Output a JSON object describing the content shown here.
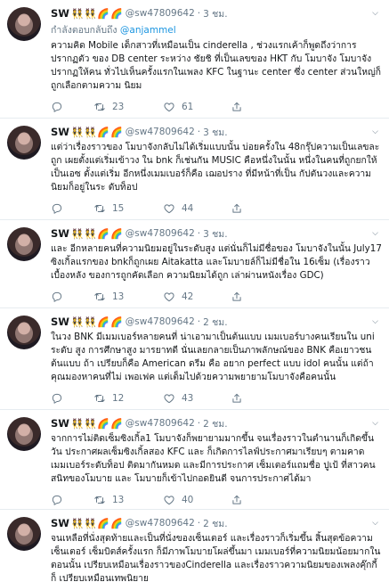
{
  "tweets": [
    {
      "name": "SW",
      "handle": "@sw47809642",
      "time": "3 ชม.",
      "reply_prefix": "กำลังตอบกลับถึง ",
      "reply_mention": "@anjammel",
      "text": "ความคิด Mobile เด็กสาวที่เหมือนเป็น cinderella , ช่วงแรกเค้าก็พูดถึงว่าการปรากฏตัว ของ DB center ระหว่าง ชัยชิ ที่เป็นเลขของ HKT กับ โมบาจัง โมบาจังปรากฏให้คน ทั่วไปเห็นครั้งแรกในเพลง KFC ในฐานะ center ซึ่ง center ส่วนใหญ่ก็ถูกเลือกตามความ นิยม",
      "retweets": "23",
      "likes": "61"
    },
    {
      "name": "SW",
      "handle": "@sw47809642",
      "time": "3 ชม.",
      "reply_prefix": "",
      "reply_mention": "",
      "text": "แต่ว่าเรื่องราวของ โมบาจังกลับไม่ได้เริ่มแบบนั้น บ่อยครั้งใน 48กรุ๊ปความเป็นเลขละถูก เผยตั้งแต่เริ่มเข้าวง ใน bnk ก็เช่นกัน MUSIC คือหนึ่งในนั้น หนึ่งในคนที่ถูกยกให้เป็นเอซ ตั้งแต่เริ่ม อีกหนึ่งเมมเบอร์ก็คือ เฌอปราง ที่มีหน้าที่เป็น กัปตันวงและความนิยมก็อยู่ในระ ดับท็อป",
      "retweets": "15",
      "likes": "44"
    },
    {
      "name": "SW",
      "handle": "@sw47809642",
      "time": "3 ชม.",
      "reply_prefix": "",
      "reply_mention": "",
      "text": "และ อีกหลายคนที่ความนิยมอยู่ในระดับสูง แต่นั่นก็ไม่มีชื่อของ โมบาจังในนั้น July17 ซิงเกิ้ลแรกของ bnkก็ถูกเผย Aitakatta และโมบายล์ก็ไม่มีชื่อใน 16เซ็ม (เรื่องราว เบื้องหลัง ของการถูกคัดเลือก ความนิยมได้ถูก เล่าผ่านหนังเรื่อง GDC)",
      "retweets": "13",
      "likes": "42"
    },
    {
      "name": "SW",
      "handle": "@sw47809642",
      "time": "2 ชม.",
      "reply_prefix": "",
      "reply_mention": "",
      "text": "ในวง BNK มีเมมเบอร์หลายคนที่ น่าเอามาเป็นต้นแบบ เมมเบอร์บางคนเรียนใน uni ระดับ สูง การศึกษาสูง มารยาทดี นั่นเลยกลายเป็นภาพลักษณ์ของ BNK คือเยาวชนต้นแบบ ถ้า เปรียบก็คือ American ดรีม คือ อยาก perfect แบบ idol คนนั้น แต่ถ้าคุณมองหาคนที่ไม่ เพอเฟค แต่เต็มไปด้วยความพยายามโมบาจังคือคนนั้น",
      "retweets": "12",
      "likes": "43"
    },
    {
      "name": "SW",
      "handle": "@sw47809642",
      "time": "2 ชม.",
      "reply_prefix": "",
      "reply_mention": "",
      "text": "จากการไม่ติดเซ็มซิงเกิ้ล1 โมบาจังก็พยายามมากขึ้น จนเรื่องราวในตำนานก็เกิดขึ้น วัน ประกาศผลเซ็มซิงเกิ้ลสอง KFC และ ก็เกิดการไลฟ์ประกาศมาเรียบๆ ตามคาด เมมเบอร์ระดับท็อป ติดมากันหมด และมีการประกาศ เซ็มเตอร์แถมชื่อ ปูเป้ ที่สาวคนสนิทของโมบาย และ โมบายก็เข้าไปกอดยินดี จนการประกาศได้มา",
      "retweets": "13",
      "likes": "40"
    },
    {
      "name": "SW",
      "handle": "@sw47809642",
      "time": "2 ชม.",
      "reply_prefix": "",
      "reply_mention": "",
      "text": "จนเหลือที่นั่งสุดท้ายและเป็นที่นั่งของเซ็นเตอร์ และเรื่องราวก็เริ่มขึ้น สิ้นสุดข้อความ เซ็นเตอร์ เซ็มบิตส์ครั้งแรก ก็มีภาพโมบายโผล่ขึ้นมา เมมเบอร์ที่ความนิยมน้อยมากใน ตอนนั้น เปรียบเหมือนเรื่องราวของCinderella และเรื่องราวความนิยมของเพลงคุ๊กกี้ก็ เปรียบเหมือนเทพนิยาย",
      "retweets": "",
      "likes": ""
    }
  ],
  "badges": [
    "👯",
    "👯",
    "🌈",
    "🌈"
  ],
  "colors": {
    "link": "#1b95e0",
    "muted": "#657786",
    "divider": "#e6ecf0"
  }
}
